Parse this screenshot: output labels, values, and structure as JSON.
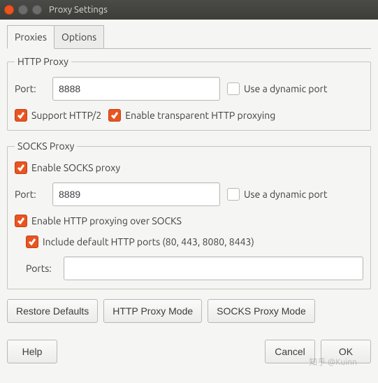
{
  "window": {
    "title": "Proxy Settings"
  },
  "tabs": {
    "proxies": "Proxies",
    "options": "Options"
  },
  "http_proxy": {
    "legend": "HTTP Proxy",
    "port_label": "Port:",
    "port_value": "8888",
    "dynamic_port_label": "Use a dynamic port",
    "dynamic_port_checked": false,
    "support_http2_label": "Support HTTP/2",
    "support_http2_checked": true,
    "transparent_label": "Enable transparent HTTP proxying",
    "transparent_checked": true
  },
  "socks_proxy": {
    "legend": "SOCKS Proxy",
    "enable_label": "Enable SOCKS proxy",
    "enable_checked": true,
    "port_label": "Port:",
    "port_value": "8889",
    "dynamic_port_label": "Use a dynamic port",
    "dynamic_port_checked": false,
    "http_over_socks_label": "Enable HTTP proxying over SOCKS",
    "http_over_socks_checked": true,
    "include_default_label": "Include default HTTP ports (80, 443, 8080, 8443)",
    "include_default_checked": true,
    "ports_label": "Ports:",
    "ports_value": ""
  },
  "buttons": {
    "restore_defaults": "Restore Defaults",
    "http_proxy_mode": "HTTP Proxy Mode",
    "socks_proxy_mode": "SOCKS Proxy Mode",
    "help": "Help",
    "cancel": "Cancel",
    "ok": "OK"
  },
  "watermark": "知乎 @Kuinn"
}
